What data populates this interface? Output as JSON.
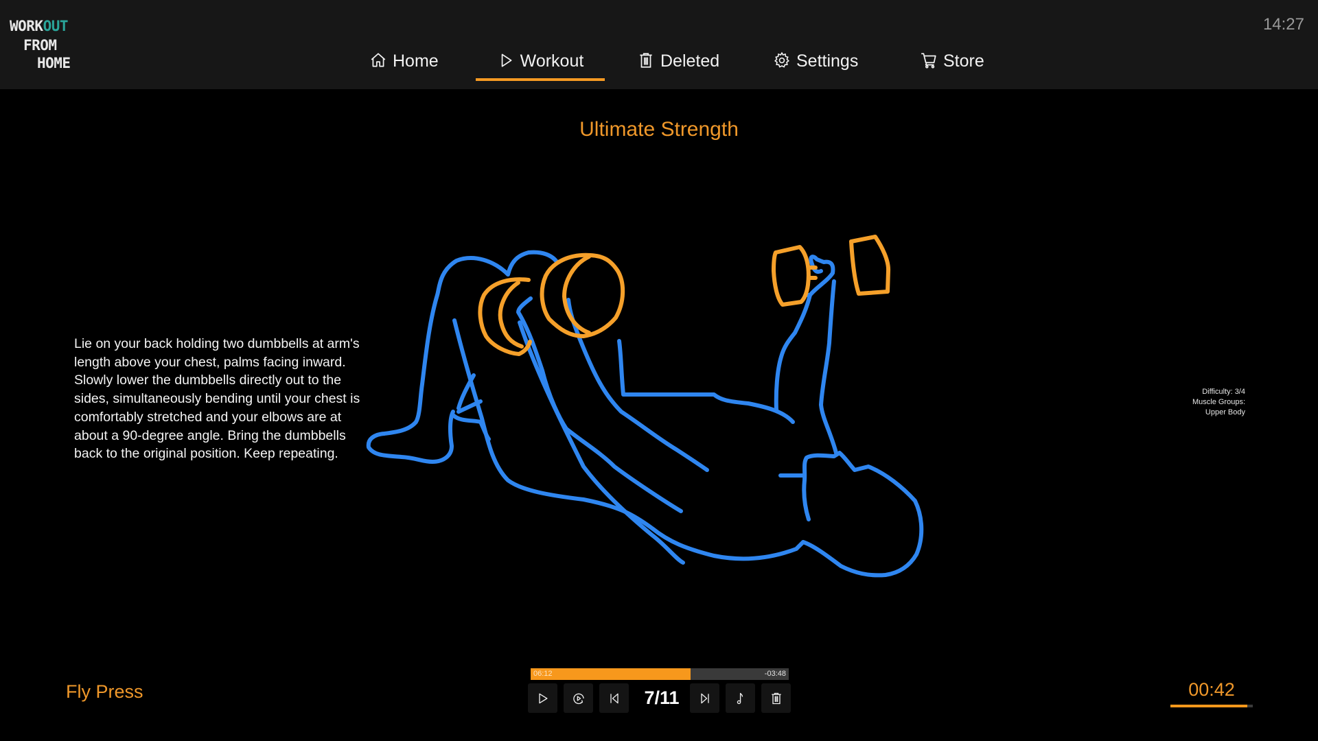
{
  "app": {
    "logo": {
      "line1_a": "WORK",
      "line1_b": "OUT",
      "line2": "FROM",
      "line3": "HOME"
    },
    "clock": "14:27"
  },
  "nav": {
    "items": [
      {
        "label": "Home",
        "icon": "home-icon",
        "active": false
      },
      {
        "label": "Workout",
        "icon": "play-icon",
        "active": true
      },
      {
        "label": "Deleted",
        "icon": "trash-icon",
        "active": false
      },
      {
        "label": "Settings",
        "icon": "gear-icon",
        "active": false
      },
      {
        "label": "Store",
        "icon": "cart-icon",
        "active": false
      }
    ]
  },
  "workout": {
    "title": "Ultimate Strength",
    "description": "Lie on your back holding two dumbbells at arm's length above your chest, palms facing inward. Slowly lower the dumbbells directly out to the sides, simultaneously bending until your chest is comfortably stretched and your elbows are at about a 90-degree angle. Bring the dumbbells back to the original position. Keep repeating.",
    "info": {
      "difficulty": "Difficulty: 3/4",
      "muscle_label": "Muscle Groups:",
      "muscle_value": "Upper Body"
    },
    "illustration": "fly-press-figure",
    "colors": {
      "figure": "#2f86f0",
      "equipment": "#f5a02a",
      "accent": "#f59a23"
    }
  },
  "player": {
    "exercise_name": "Fly Press",
    "elapsed": "06:12",
    "remaining": "-03:48",
    "progress_fraction": 0.62,
    "counter": "7/11",
    "controls": [
      {
        "name": "play-button",
        "icon": "play-icon"
      },
      {
        "name": "replay-button",
        "icon": "replay-icon"
      },
      {
        "name": "previous-button",
        "icon": "skip-previous-icon"
      },
      {
        "name": "next-button",
        "icon": "skip-next-icon"
      },
      {
        "name": "music-button",
        "icon": "music-note-icon"
      },
      {
        "name": "delete-button",
        "icon": "trash-icon"
      }
    ],
    "exercise_timer": "00:42",
    "exercise_timer_fraction": 0.93
  }
}
